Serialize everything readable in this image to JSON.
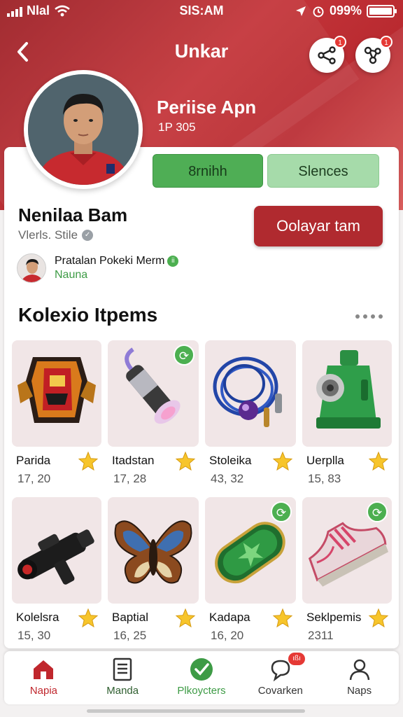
{
  "status_bar": {
    "carrier": "Nlal",
    "time": "SIS:AM",
    "battery_text": "099%",
    "battery_level": 0.99,
    "icons": [
      "signal-icon",
      "wifi-icon",
      "location-icon",
      "alarm-icon",
      "battery-icon"
    ]
  },
  "nav": {
    "title": "Unkar",
    "back_icon": "chevron-left-icon",
    "share_badge": "1",
    "link_badge": "1"
  },
  "profile": {
    "hero_name": "Periise Apn",
    "hero_sub": "1P 305",
    "tabs": [
      "8rnihh",
      "Slences"
    ],
    "name": "Nenilaa Bam",
    "meta": "Vlerls. Stile",
    "action_button": "Oolayar tam",
    "friend": {
      "text": "Pratalan Pokeki Merm",
      "badge": "ii",
      "sub": "Nauna"
    }
  },
  "collection": {
    "title": "Kolexio Itpems",
    "items": [
      {
        "name": "Parida",
        "value": "17, 20",
        "icon": "badge-emblem-icon",
        "badge": false
      },
      {
        "name": "Itadstan",
        "value": "17, 28",
        "icon": "flashlight-icon",
        "badge": true
      },
      {
        "name": "Stoleika",
        "value": "43, 32",
        "icon": "rope-amulet-icon",
        "badge": false
      },
      {
        "name": "Uerplla",
        "value": "15, 83",
        "icon": "machine-icon",
        "badge": false
      },
      {
        "name": "Kolelsra",
        "value": "15, 30",
        "icon": "blaster-icon",
        "badge": false
      },
      {
        "name": "Baptial",
        "value": "16, 25",
        "icon": "butterfly-icon",
        "badge": false
      },
      {
        "name": "Kadapa",
        "value": "16, 20",
        "icon": "leaf-pod-icon",
        "badge": true
      },
      {
        "name": "Seklpemis",
        "value": "2311",
        "icon": "sneaker-icon",
        "badge": true
      }
    ]
  },
  "bottom_nav": {
    "items": [
      {
        "label": "Napia",
        "icon": "home-icon",
        "color": "#c0272d"
      },
      {
        "label": "Manda",
        "icon": "document-icon",
        "color": "#2e5e2f"
      },
      {
        "label": "Plkoycters",
        "icon": "check-circle-icon",
        "color": "#3d9b45"
      },
      {
        "label": "Covarken",
        "icon": "chat-icon",
        "color": "#333333",
        "badge": "ıßı"
      },
      {
        "label": "Naps",
        "icon": "user-icon",
        "color": "#333333"
      }
    ]
  },
  "colors": {
    "brand_red": "#b02a2f",
    "accent_green": "#4fae55",
    "light_green": "#a6dbaa"
  }
}
